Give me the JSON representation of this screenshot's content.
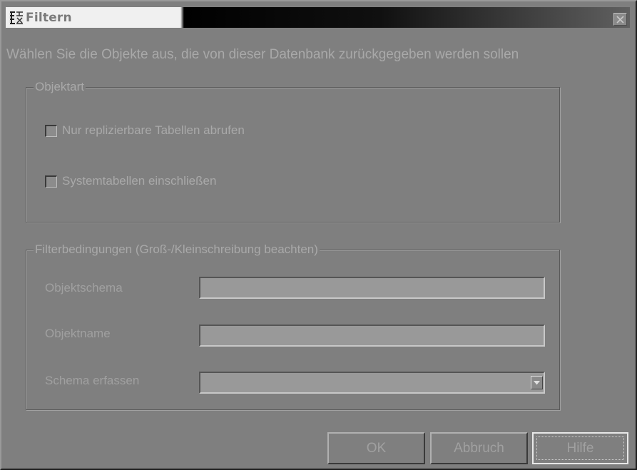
{
  "window": {
    "title": "Filtern",
    "icon": "filter-app-icon",
    "close_icon": "close-icon"
  },
  "instruction": "Wählen Sie die Objekte aus, die von dieser Datenbank zurückgegeben werden sollen",
  "object_type_group": {
    "legend": "Objektart",
    "checkboxes": [
      {
        "label": "Nur replizierbare Tabellen abrufen",
        "checked": false
      },
      {
        "label": "Systemtabellen einschließen",
        "checked": false
      }
    ]
  },
  "filter_group": {
    "legend": "Filterbedingungen (Groß-/Kleinschreibung beachten)",
    "fields": [
      {
        "label": "Objektschema",
        "value": ""
      },
      {
        "label": "Objektname",
        "value": ""
      },
      {
        "label": "Schema erfassen",
        "value": "",
        "dropdown_icon": "chevron-down-icon"
      }
    ]
  },
  "buttons": {
    "ok": "OK",
    "cancel": "Abbruch",
    "help": "Hilfe"
  },
  "colors": {
    "background": "#7f7f7f",
    "text": "#a9a9a9",
    "field": "#999999"
  }
}
